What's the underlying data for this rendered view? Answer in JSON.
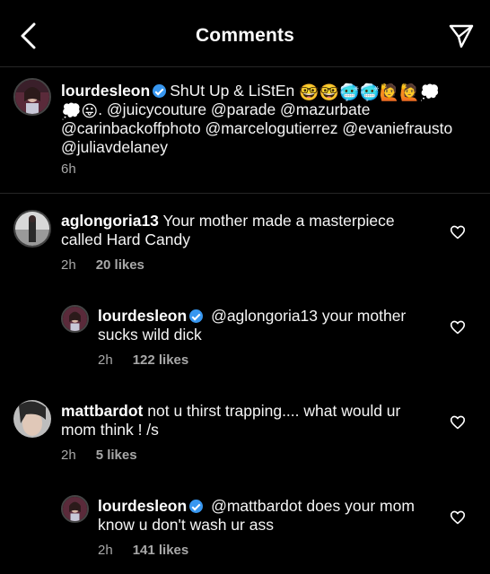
{
  "header": {
    "title": "Comments",
    "back_icon": "chevron-left-icon",
    "send_icon": "paper-plane-icon"
  },
  "caption": {
    "username": "lourdesleon",
    "verified": true,
    "text_start": "ShUt Up & LiStEn",
    "emojis": [
      "🤓",
      "🤓",
      "🥶",
      "🥶",
      "🙋",
      "🙋",
      "💭",
      "💭",
      "😛"
    ],
    "text_rest": ". @juicycouture @parade @mazurbate @carinbackoffphoto @marcelogutierrez @evaniefrausto @juliavdelaney",
    "time": "6h"
  },
  "comments": [
    {
      "username": "aglongoria13",
      "verified": false,
      "text": "Your mother made a masterpiece called Hard Candy",
      "time": "2h",
      "likes": "20 likes",
      "reply": false
    },
    {
      "username": "lourdesleon",
      "verified": true,
      "text": "@aglongoria13 your mother sucks wild dick",
      "time": "2h",
      "likes": "122 likes",
      "reply": true
    },
    {
      "username": "mattbardot",
      "verified": false,
      "text": "not u thirst trapping.... what would ur mom think ! /s",
      "time": "2h",
      "likes": "5 likes",
      "reply": false
    },
    {
      "username": "lourdesleon",
      "verified": true,
      "text": "@mattbardot does your mom know u don't wash ur ass",
      "time": "2h",
      "likes": "141 likes",
      "reply": true
    }
  ],
  "colors": {
    "background": "#000000",
    "text": "#ffffff",
    "secondary_text": "#a8a8a8",
    "verified_badge": "#3897f0",
    "divider": "#262626"
  }
}
